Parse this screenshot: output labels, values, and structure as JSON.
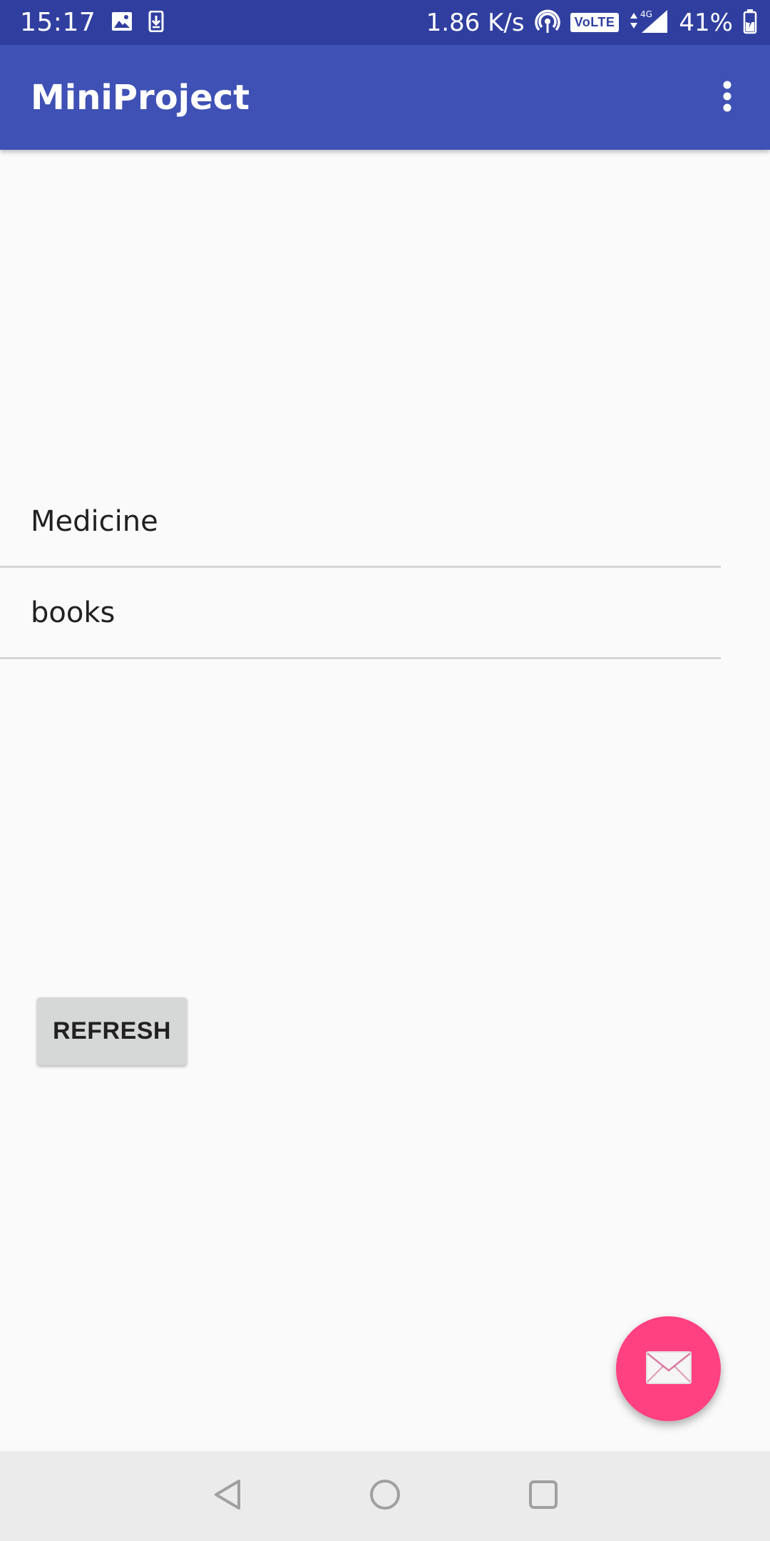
{
  "status_bar": {
    "time": "15:17",
    "network_speed": "1.86 K/s",
    "volte": "VoLTE",
    "network_type": "4G",
    "battery": "41%"
  },
  "app_bar": {
    "title": "MiniProject",
    "overflow_icon": "more-vert-icon"
  },
  "list": {
    "items": [
      {
        "label": "Medicine"
      },
      {
        "label": "books"
      }
    ]
  },
  "refresh_button": {
    "label": "REFRESH"
  },
  "fab": {
    "icon": "email-icon",
    "color": "#ff4081"
  },
  "nav_bar": {
    "back_icon": "back-icon",
    "home_icon": "home-icon",
    "recents_icon": "recents-icon"
  },
  "colors": {
    "primary": "#3f51b5",
    "primary_dark": "#303f9f",
    "accent": "#ff4081",
    "background": "#fafafa"
  }
}
